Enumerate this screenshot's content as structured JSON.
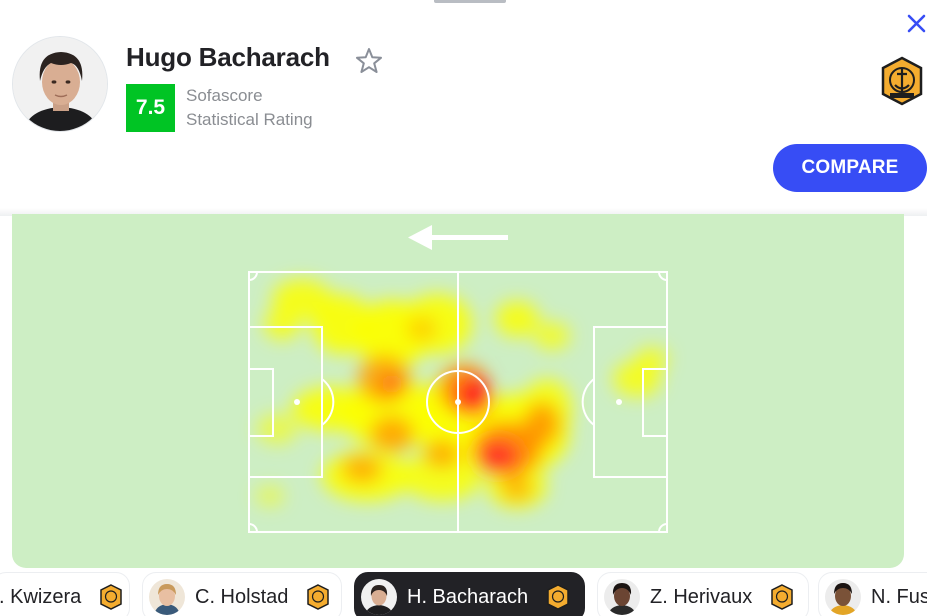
{
  "header": {
    "player_name": "Hugo Bacharach",
    "rating": "7.5",
    "rating_label_line1": "Sofascore",
    "rating_label_line2": "Statistical Rating",
    "compare_label": "COMPARE"
  },
  "icons": {
    "close": "close-icon",
    "favorite": "star-outline-icon",
    "team": "team-crest-icon",
    "direction": "arrow-left-icon"
  },
  "colors": {
    "accent": "#374df5",
    "rating_green": "#00c424",
    "pitch": "#cdeec4",
    "heat_low": "#ffff00",
    "heat_mid": "#ff9900",
    "heat_high": "#ff1e1e"
  },
  "players": [
    {
      "name": ". Kwizera",
      "active": false
    },
    {
      "name": "C. Holstad",
      "active": false
    },
    {
      "name": "H. Bacharach",
      "active": true
    },
    {
      "name": "Z. Herivaux",
      "active": false
    },
    {
      "name": "N. Fus",
      "active": false
    }
  ]
}
